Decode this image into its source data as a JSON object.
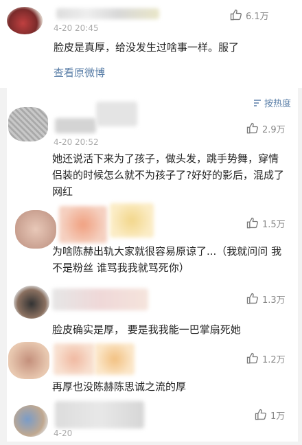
{
  "top_comment": {
    "time": "4-20 20:45",
    "likes": "6.1万",
    "text": "脸皮是真厚，给没发生过啥事一样。服了",
    "view_original": "查看原微博"
  },
  "sort_label": "按热度",
  "comments": [
    {
      "time": "4-20 20:52",
      "likes": "2.9万",
      "text": "她还说活下来为了孩子，做头发，跳手势舞，穿情侣装的时候怎么就不为孩子了?好好的影后，混成了网红"
    },
    {
      "time": "",
      "likes": "1.5万",
      "text": "为啥陈赫出轨大家就很容易原谅了...（我就问问 我不是粉丝 谁骂我我就骂死你）"
    },
    {
      "time": "",
      "likes": "1.3万",
      "text": "脸皮确实是厚， 要是我我能一巴掌扇死她"
    },
    {
      "time": "",
      "likes": "1.2万",
      "text": "再厚也没陈赫陈思诚之流的厚"
    },
    {
      "time": "4-20",
      "likes": "1万",
      "text": ""
    }
  ]
}
